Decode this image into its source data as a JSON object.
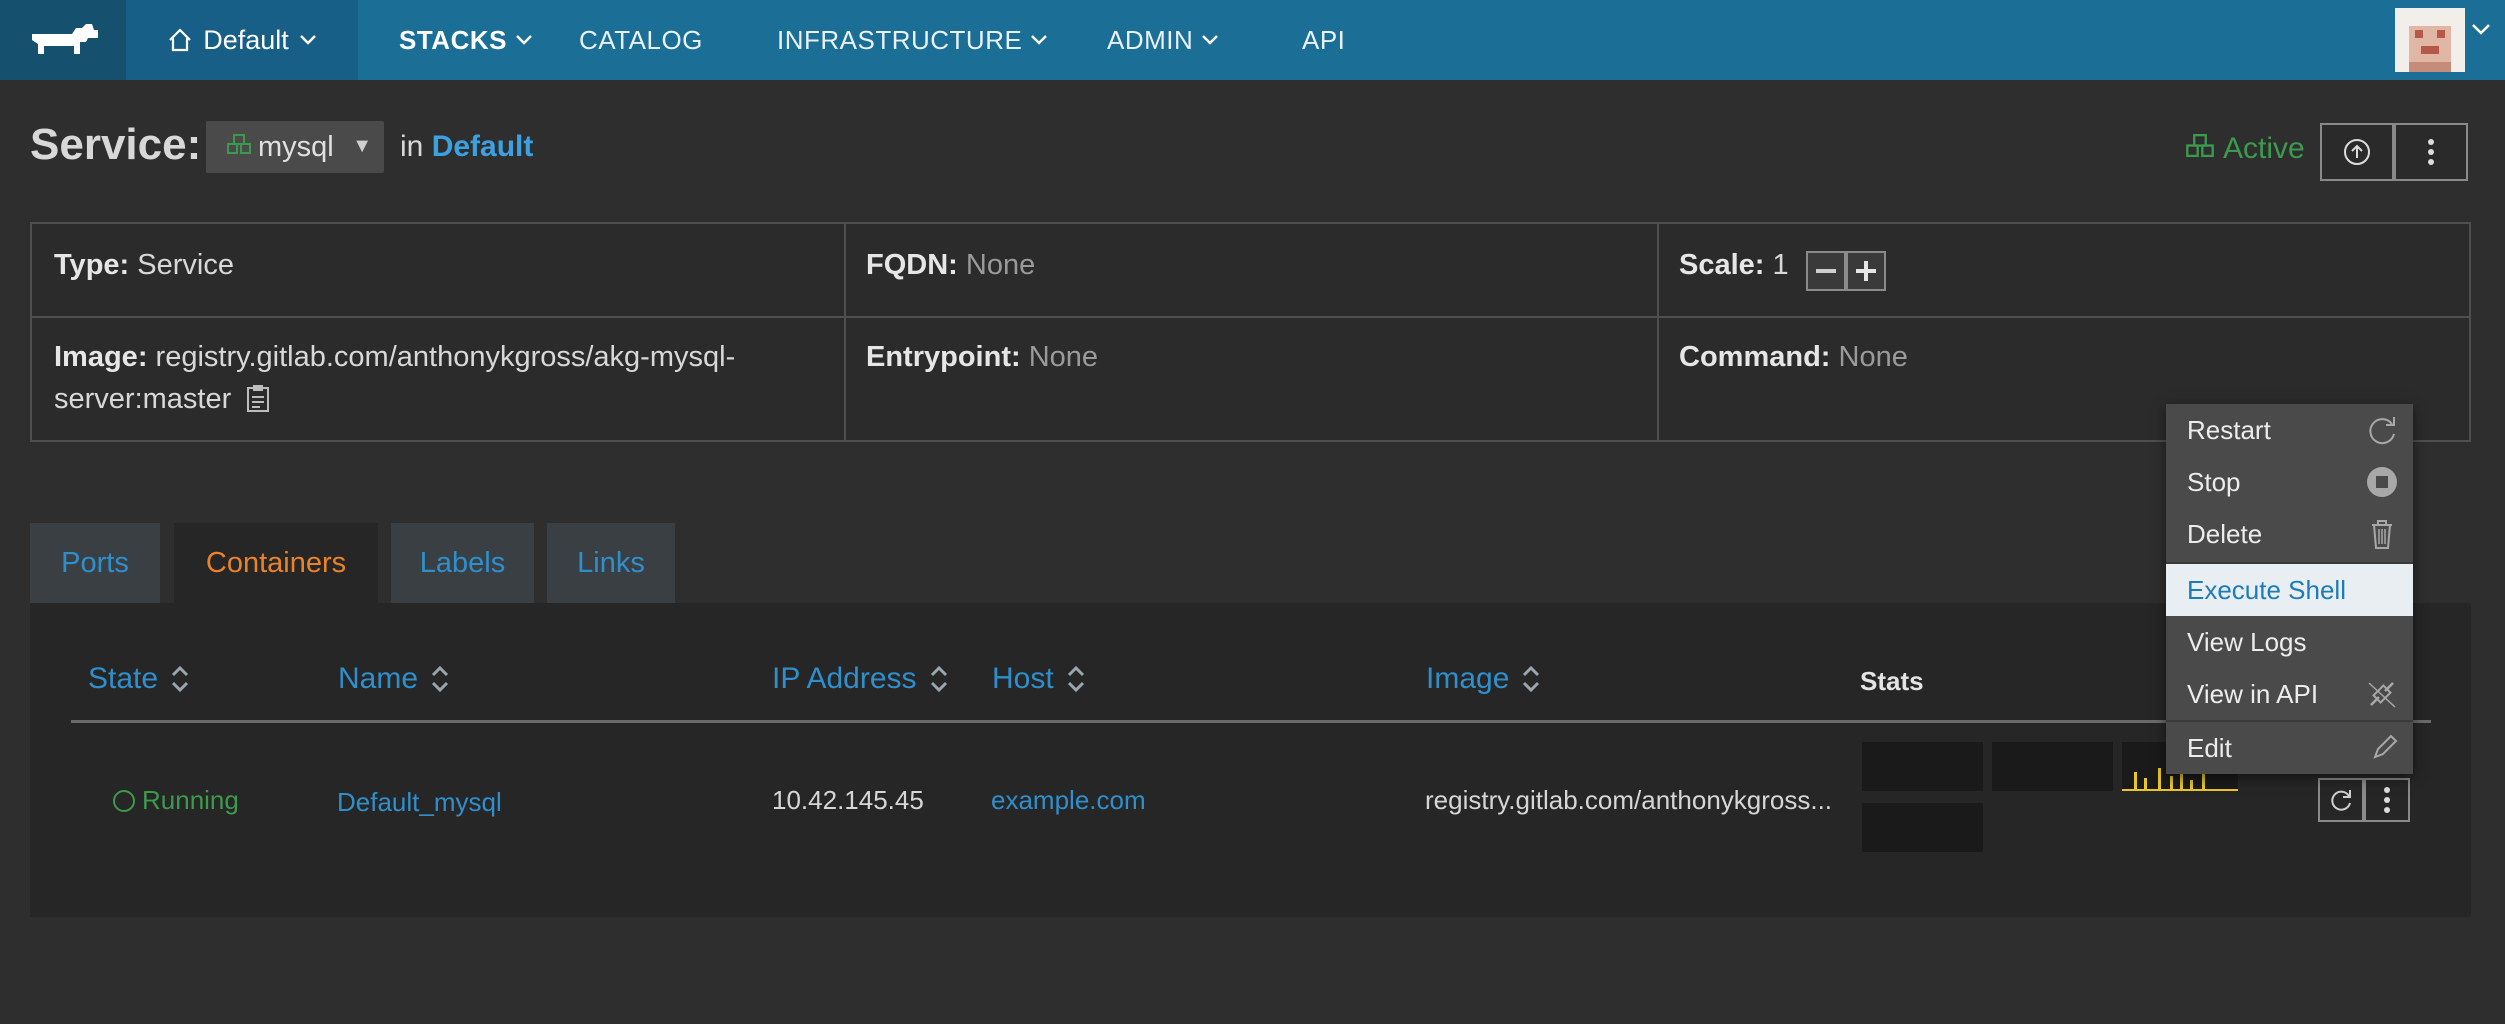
{
  "nav": {
    "environment": "Default",
    "items": [
      {
        "label": "STACKS",
        "active": true,
        "dropdown": true
      },
      {
        "label": "CATALOG",
        "active": false,
        "dropdown": false
      },
      {
        "label": "INFRASTRUCTURE",
        "active": false,
        "dropdown": true
      },
      {
        "label": "ADMIN",
        "active": false,
        "dropdown": true
      },
      {
        "label": "API",
        "active": false,
        "dropdown": false
      }
    ]
  },
  "service": {
    "title": "Service:",
    "selected": "mysql",
    "in_label": "in",
    "stack": "Default",
    "status": "Active"
  },
  "info": {
    "type_label": "Type:",
    "type_value": "Service",
    "fqdn_label": "FQDN:",
    "fqdn_value": "None",
    "scale_label": "Scale:",
    "scale_value": "1",
    "image_label": "Image:",
    "image_value": "registry.gitlab.com/anthonykgross/akg-mysql-server:master",
    "entrypoint_label": "Entrypoint:",
    "entrypoint_value": "None",
    "command_label": "Command:",
    "command_value": "None"
  },
  "tabs": [
    "Ports",
    "Containers",
    "Labels",
    "Links"
  ],
  "table": {
    "headers": [
      "State",
      "Name",
      "IP Address",
      "Host",
      "Image",
      "Stats"
    ],
    "row": {
      "state": "Running",
      "name": "Default_mysql",
      "ip": "10.42.145.45",
      "host": "example.com",
      "image": "registry.gitlab.com/anthonykgross..."
    }
  },
  "menu": {
    "items": [
      "Restart",
      "Stop",
      "Delete",
      "Execute Shell",
      "View Logs",
      "View in API",
      "Edit"
    ],
    "highlighted": "Execute Shell"
  },
  "colors": {
    "nav": "#1b6e96",
    "link": "#2f8fcc",
    "active_green": "#3b9a4c",
    "tab_active": "#e8832a"
  }
}
